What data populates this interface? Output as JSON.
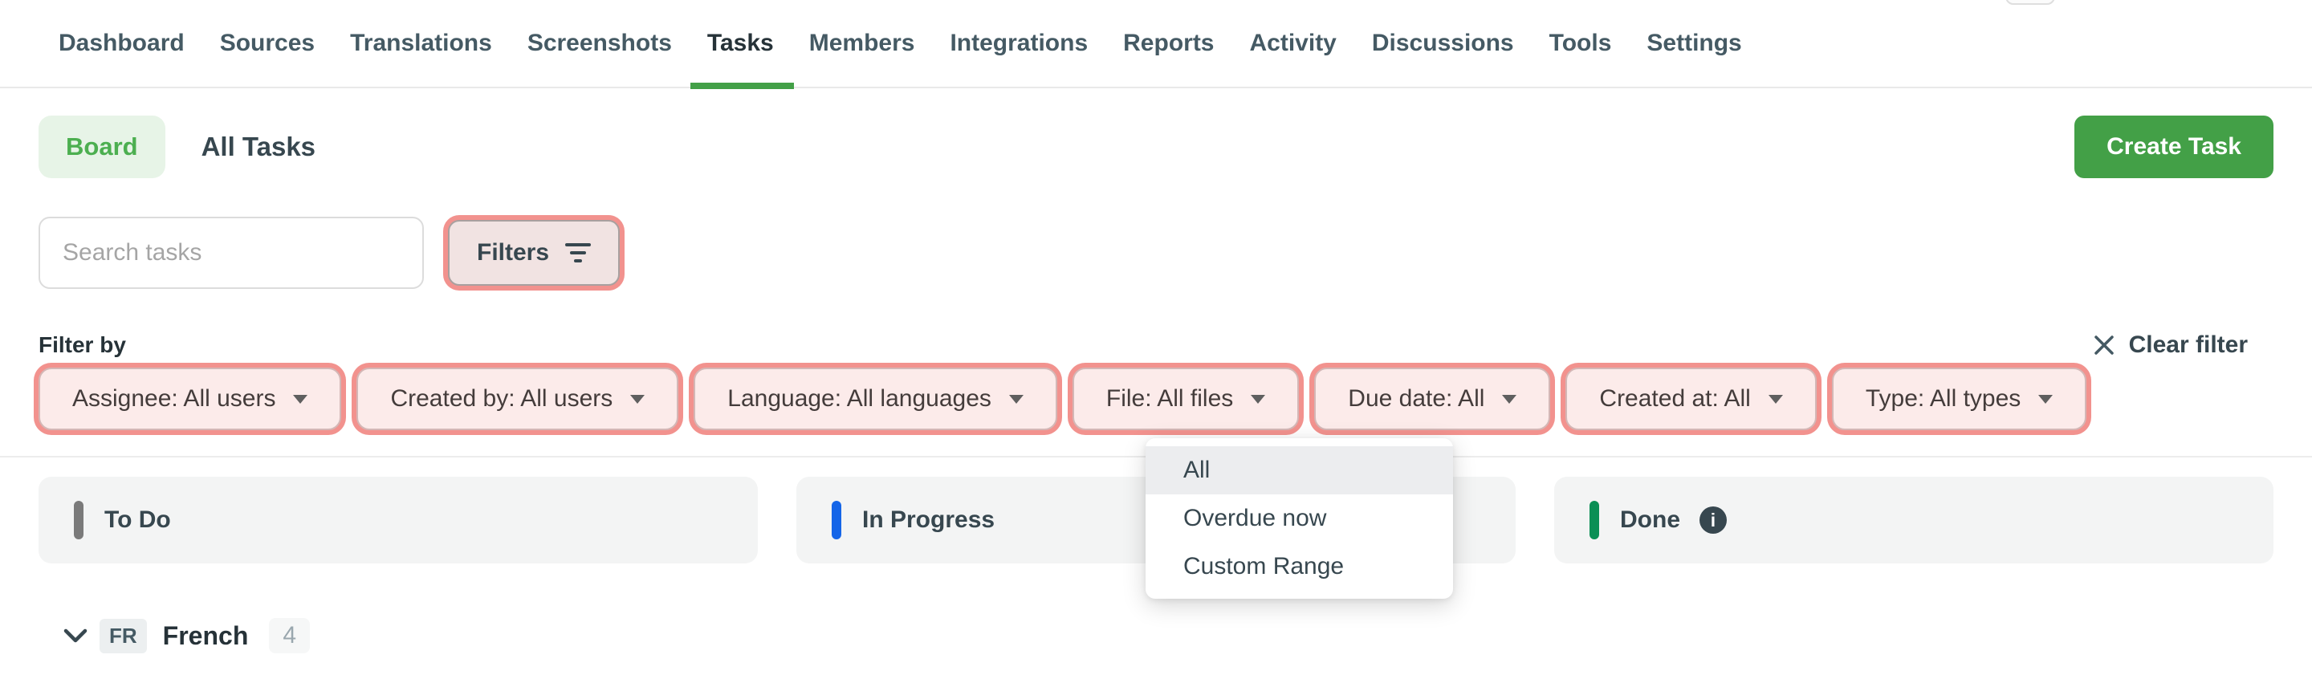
{
  "nav": {
    "items": [
      "Dashboard",
      "Sources",
      "Translations",
      "Screenshots",
      "Tasks",
      "Members",
      "Integrations",
      "Reports",
      "Activity",
      "Discussions",
      "Tools",
      "Settings"
    ],
    "active": "Tasks"
  },
  "toolbar": {
    "view_label": "Board",
    "title": "All Tasks",
    "create_button": "Create Task"
  },
  "search": {
    "placeholder": "Search tasks",
    "filters_button": "Filters"
  },
  "filter_bar": {
    "label": "Filter by",
    "clear_label": "Clear filter",
    "pills": [
      "Assignee: All users",
      "Created by: All users",
      "Language: All languages",
      "File: All files",
      "Due date: All",
      "Created at: All",
      "Type: All types"
    ]
  },
  "due_date_menu": {
    "items": [
      "All",
      "Overdue now",
      "Custom Range"
    ],
    "selected": "All"
  },
  "board": {
    "columns": [
      {
        "label": "To Do",
        "bar_color": "#7a7a7a",
        "has_info": false
      },
      {
        "label": "In Progress",
        "bar_color": "#1565e8",
        "has_info": false
      },
      {
        "label": "Done",
        "bar_color": "#0a8f55",
        "has_info": true
      }
    ]
  },
  "language_row": {
    "code": "FR",
    "name": "French",
    "count": "4"
  },
  "icons": {
    "filters": "filter-lines-icon",
    "clear": "close-icon",
    "info": "info-icon",
    "collapse": "chevron-down-icon",
    "pill_caret": "caret-down-icon"
  },
  "colors": {
    "accent_green": "#43a047",
    "board_pill_bg": "#e7f4e7",
    "highlight_ring": "#f2928e",
    "pill_bg": "#fcebea",
    "todo_bar": "#7a7a7a",
    "in_progress_bar": "#1565e8",
    "done_bar": "#0a8f55",
    "column_bg": "#f3f4f4"
  }
}
